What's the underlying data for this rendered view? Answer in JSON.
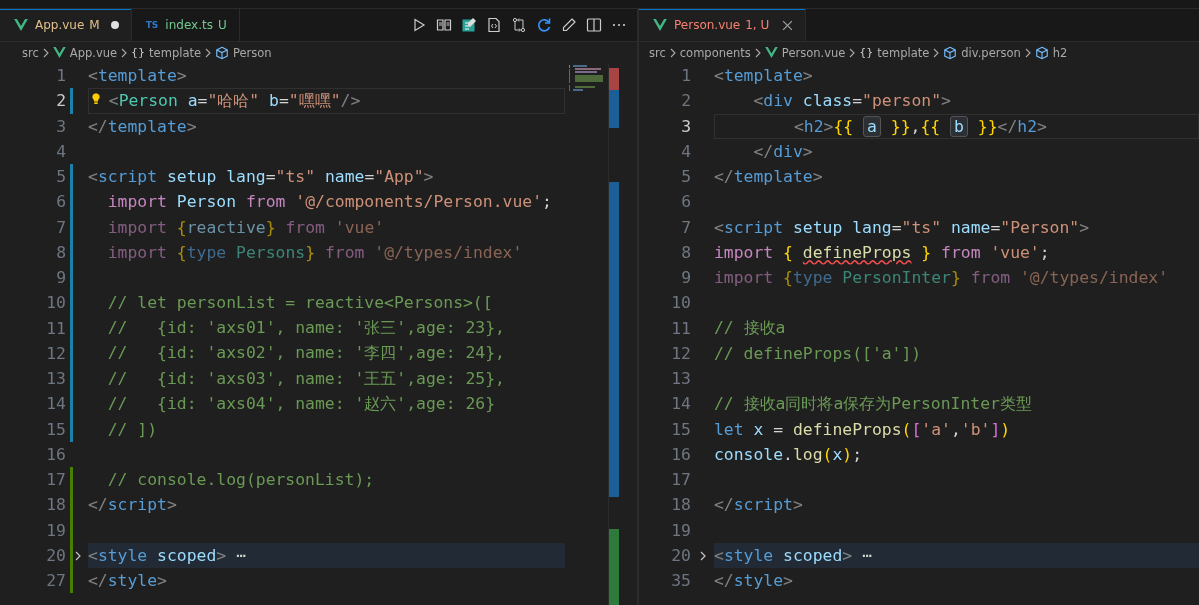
{
  "panes": [
    {
      "tabs": [
        {
          "label": "App.vue",
          "kind": "vue",
          "git": "M",
          "color": "#e2c08d",
          "dirty": true,
          "closable": false,
          "selected": true
        },
        {
          "label": "index.ts",
          "kind": "ts",
          "icon_text": "TS",
          "git": "U",
          "color": "#73c991",
          "dirty": false,
          "closable": false,
          "selected": false
        }
      ],
      "toolbar": true,
      "breadcrumb": [
        {
          "label": "src",
          "kind": "folder"
        },
        {
          "label": "App.vue",
          "kind": "vue"
        },
        {
          "label": "template",
          "kind": "braces",
          "icon_text": "{}"
        },
        {
          "label": "Person",
          "kind": "element"
        }
      ],
      "minimap": true,
      "lines": [
        {
          "n": "1",
          "text": "<template>"
        },
        {
          "n": "2",
          "current": true,
          "bulb": true,
          "modified": true,
          "text": "  <Person a=\"哈哈\" b=\"嘿嘿\"/>"
        },
        {
          "n": "3",
          "text": "</template>"
        },
        {
          "n": "4"
        },
        {
          "n": "5",
          "modified": true,
          "text": "<script setup lang=\"ts\" name=\"App\">"
        },
        {
          "n": "6",
          "modified": true,
          "text": "  import Person from '@/components/Person.vue';"
        },
        {
          "n": "7",
          "modified": true,
          "faded": true,
          "text": "  import {reactive} from 'vue'"
        },
        {
          "n": "8",
          "modified": true,
          "faded": true,
          "text": "  import {type Persons} from '@/types/index'"
        },
        {
          "n": "9",
          "modified": true
        },
        {
          "n": "10",
          "modified": true,
          "text": "  // let personList = reactive<Persons>(["
        },
        {
          "n": "11",
          "modified": true,
          "text": "  //   {id: 'axs01', name: '张三',age: 23},"
        },
        {
          "n": "12",
          "modified": true,
          "text": "  //   {id: 'axs02', name: '李四',age: 24},"
        },
        {
          "n": "13",
          "modified": true,
          "text": "  //   {id: 'axs03', name: '王五',age: 25},"
        },
        {
          "n": "14",
          "modified": true,
          "text": "  //   {id: 'axs04', name: '赵六',age: 26}"
        },
        {
          "n": "15",
          "modified": true,
          "text": "  // ])"
        },
        {
          "n": "16"
        },
        {
          "n": "17",
          "added": true,
          "text": "  // console.log(personList);"
        },
        {
          "n": "18",
          "added": true,
          "text": "</script>"
        },
        {
          "n": "19",
          "added": true
        },
        {
          "n": "20",
          "added": true,
          "folded": true,
          "text": "<style scoped> ⋯"
        },
        {
          "n": "27",
          "added": true,
          "text": "</style>"
        }
      ]
    },
    {
      "tabs": [
        {
          "label": "Person.vue",
          "kind": "vue",
          "git": "1, U",
          "color": "#f88070",
          "dirty": false,
          "closable": true,
          "selected": true
        }
      ],
      "breadcrumb": [
        {
          "label": "src",
          "kind": "folder"
        },
        {
          "label": "components",
          "kind": "folder"
        },
        {
          "label": "Person.vue",
          "kind": "vue"
        },
        {
          "label": "template",
          "kind": "braces",
          "icon_text": "{}"
        },
        {
          "label": "div.person",
          "kind": "element"
        },
        {
          "label": "h2",
          "kind": "element"
        }
      ],
      "lines": [
        {
          "n": "1",
          "text": "<template>"
        },
        {
          "n": "2",
          "text": "    <div class=\"person\">"
        },
        {
          "n": "3",
          "current": true,
          "text": "        <h2>{{ a }},{{ b }}</h2>"
        },
        {
          "n": "4",
          "text": "    </div>"
        },
        {
          "n": "5",
          "text": "</template>"
        },
        {
          "n": "6"
        },
        {
          "n": "7",
          "text": "<script setup lang=\"ts\" name=\"Person\">"
        },
        {
          "n": "8",
          "error": true,
          "text": "import { defineProps } from 'vue';"
        },
        {
          "n": "9",
          "faded": true,
          "text": "import {type PersonInter} from '@/types/index'"
        },
        {
          "n": "10"
        },
        {
          "n": "11",
          "text": "// 接收a"
        },
        {
          "n": "12",
          "text": "// defineProps(['a'])"
        },
        {
          "n": "13"
        },
        {
          "n": "14",
          "text": "// 接收a同时将a保存为PersonInter类型"
        },
        {
          "n": "15",
          "text": "let x = defineProps(['a','b'])"
        },
        {
          "n": "16",
          "text": "console.log(x);"
        },
        {
          "n": "17"
        },
        {
          "n": "18",
          "text": "</script>"
        },
        {
          "n": "19"
        },
        {
          "n": "20",
          "folded": true,
          "text": "<style scoped> ⋯"
        },
        {
          "n": "35",
          "text": "</style>"
        }
      ]
    }
  ]
}
